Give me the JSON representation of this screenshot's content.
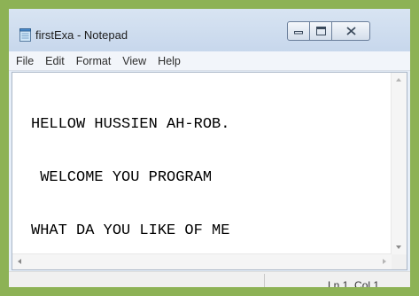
{
  "window": {
    "title": "firstExa - Notepad",
    "icon": "notepad-icon"
  },
  "menu": {
    "items": [
      {
        "label": "File"
      },
      {
        "label": "Edit"
      },
      {
        "label": "Format"
      },
      {
        "label": "View"
      },
      {
        "label": "Help"
      }
    ]
  },
  "editor": {
    "lines": [
      "HELLOW HUSSIEN AH-ROB.",
      " WELCOME YOU PROGRAM",
      "WHAT DA YOU LIKE OF ME"
    ]
  },
  "status": {
    "position": "Ln 1, Col 1"
  },
  "colors": {
    "background": "#8db255",
    "titlebar": "#d8e4f2",
    "menubar": "#f2f5fa",
    "editor": "#ffffff"
  }
}
